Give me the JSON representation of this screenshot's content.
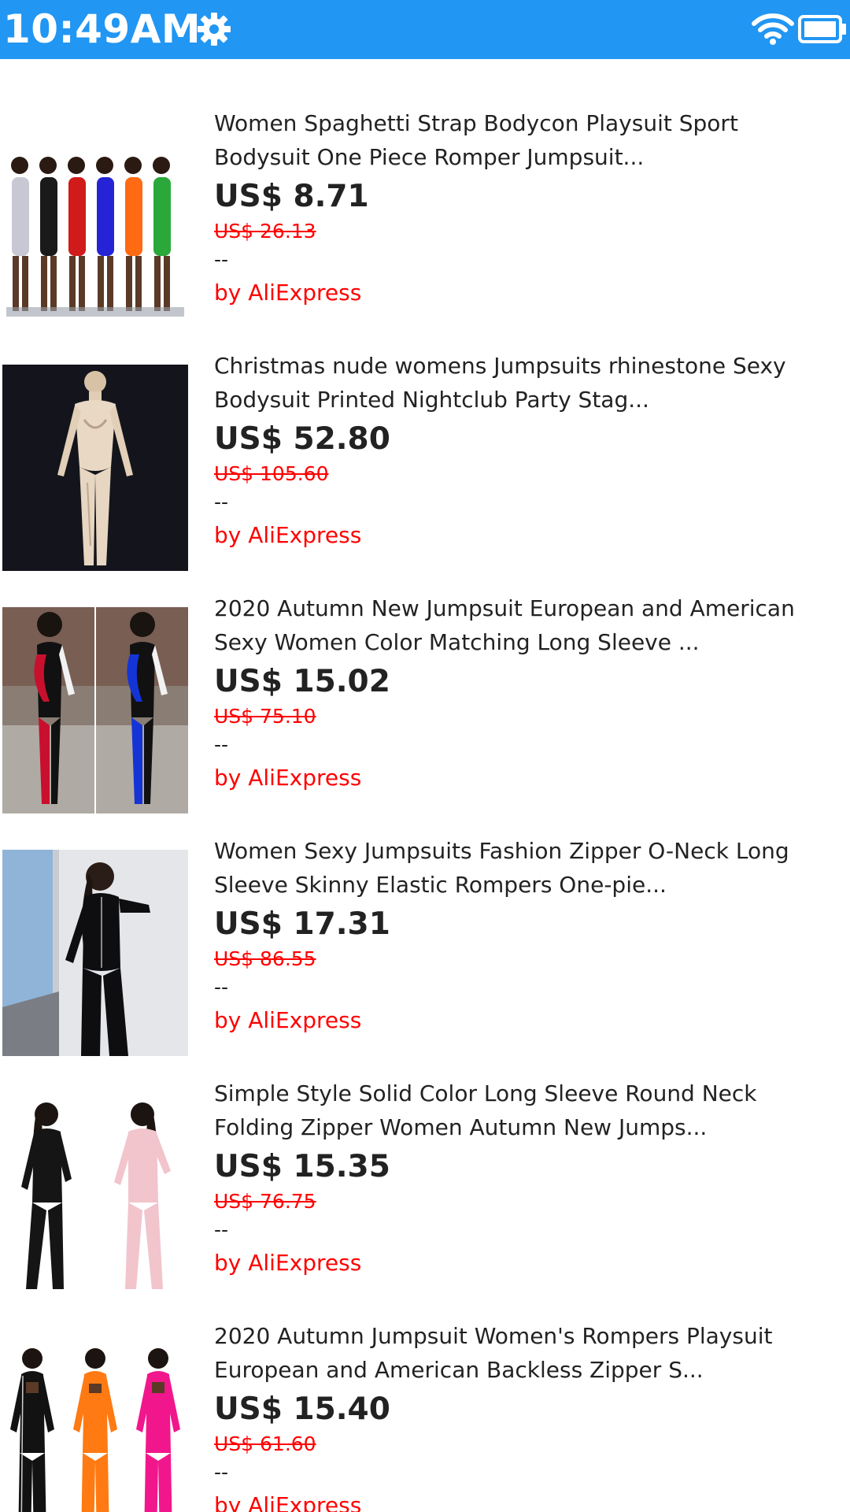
{
  "status_bar": {
    "time": "10:49AM",
    "color": "#2196F3",
    "icons": [
      "gear-icon",
      "wifi-icon",
      "battery-icon"
    ]
  },
  "products": [
    {
      "title": "Women Spaghetti Strap Bodycon Playsuit Sport Bodysuit One Piece Romper Jumpsuit...",
      "price": "US$ 8.71",
      "original_price": "US$ 26.13",
      "dashes": "--",
      "seller": "by AliExpress",
      "image": "six-color-rompers"
    },
    {
      "title": "Christmas nude womens Jumpsuits rhinestone Sexy Bodysuit Printed Nightclub Party Stag...",
      "price": "US$ 52.80",
      "original_price": "US$ 105.60",
      "dashes": "--",
      "seller": "by AliExpress",
      "image": "nude-rhinestone-jumpsuit"
    },
    {
      "title": "2020 Autumn New Jumpsuit European and American Sexy Women Color Matching Long Sleeve ...",
      "price": "US$ 15.02",
      "original_price": "US$ 75.10",
      "dashes": "--",
      "seller": "by AliExpress",
      "image": "red-blue-color-block-jumpsuits"
    },
    {
      "title": "Women Sexy Jumpsuits Fashion Zipper O-Neck Long Sleeve Skinny Elastic Rompers One-pie...",
      "price": "US$ 17.31",
      "original_price": "US$ 86.55",
      "dashes": "--",
      "seller": "by AliExpress",
      "image": "black-zipper-jumpsuit"
    },
    {
      "title": "Simple Style Solid Color Long Sleeve Round Neck Folding Zipper Women Autumn New Jumps...",
      "price": "US$ 15.35",
      "original_price": "US$ 76.75",
      "dashes": "--",
      "seller": "by AliExpress",
      "image": "black-pink-jumpsuits"
    },
    {
      "title": "2020 Autumn Jumpsuit Women's Rompers Playsuit European and American Backless Zipper S...",
      "price": "US$ 15.40",
      "original_price": "US$ 61.60",
      "dashes": "--",
      "seller": "by AliExpress",
      "image": "black-orange-pink-jumpsuits"
    }
  ]
}
